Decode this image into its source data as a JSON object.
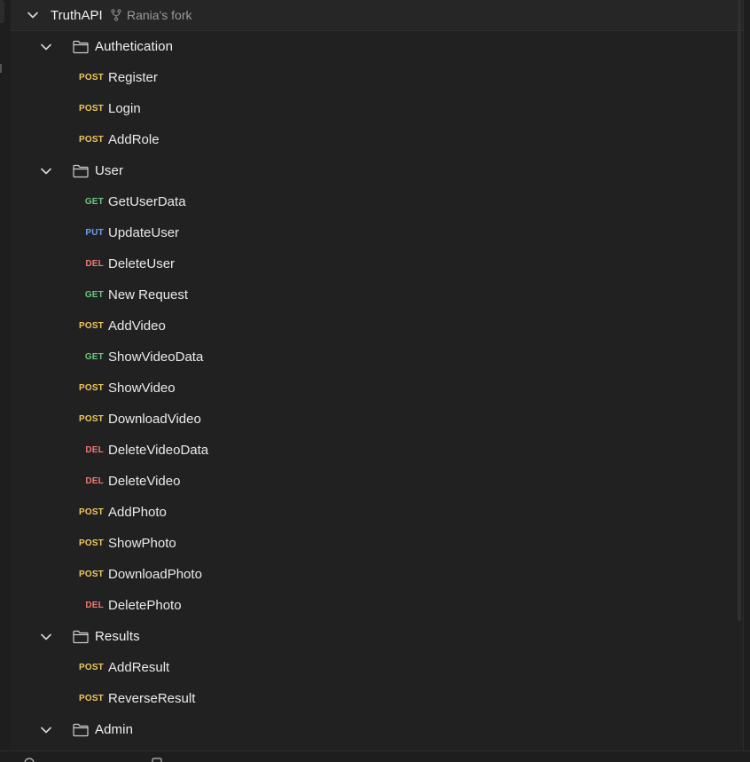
{
  "colors": {
    "post": "#f0c85a",
    "get": "#6bc77d",
    "put": "#6ea2f0",
    "del": "#f07a72"
  },
  "root": {
    "title": "TruthAPI",
    "fork_icon": "fork-icon",
    "fork_label": "Rania's fork"
  },
  "folders": {
    "authentication": {
      "label": "Authetication"
    },
    "user": {
      "label": "User"
    },
    "results": {
      "label": "Results"
    },
    "admin": {
      "label": "Admin"
    }
  },
  "requests": [
    {
      "method": "POST",
      "name": "Register"
    },
    {
      "method": "POST",
      "name": "Login"
    },
    {
      "method": "POST",
      "name": "AddRole"
    },
    {
      "method": "GET",
      "name": "GetUserData"
    },
    {
      "method": "PUT",
      "name": "UpdateUser"
    },
    {
      "method": "DEL",
      "name": "DeleteUser"
    },
    {
      "method": "GET",
      "name": "New Request"
    },
    {
      "method": "POST",
      "name": "AddVideo"
    },
    {
      "method": "GET",
      "name": "ShowVideoData"
    },
    {
      "method": "POST",
      "name": "ShowVideo"
    },
    {
      "method": "POST",
      "name": "DownloadVideo"
    },
    {
      "method": "DEL",
      "name": "DeleteVideoData"
    },
    {
      "method": "DEL",
      "name": "DeleteVideo"
    },
    {
      "method": "POST",
      "name": "AddPhoto"
    },
    {
      "method": "POST",
      "name": "ShowPhoto"
    },
    {
      "method": "POST",
      "name": "DownloadPhoto"
    },
    {
      "method": "DEL",
      "name": "DeletePhoto"
    },
    {
      "method": "POST",
      "name": "AddResult"
    },
    {
      "method": "POST",
      "name": "ReverseResult"
    }
  ]
}
